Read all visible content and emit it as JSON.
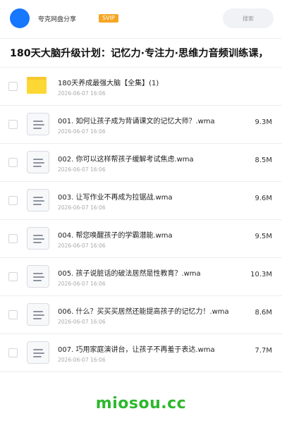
{
  "header": {
    "brand": "夸克网盘分享",
    "badge": "SVIP",
    "search_placeholder": "搜索"
  },
  "title": "180天大脑升级计划：记忆力·专注力·思维力音频训练课，",
  "files": [
    {
      "type": "folder",
      "name": "180天养成最强大脑【全集】(1)",
      "date": "2026-06-07 16:06",
      "size": ""
    },
    {
      "type": "audio",
      "name": "001. 如何让孩子成为背诵课文的记忆大师？.wma",
      "date": "2026-06-07 16:06",
      "size": "9.3M"
    },
    {
      "type": "audio",
      "name": "002. 你可以这样帮孩子缓解考试焦虑.wma",
      "date": "2026-06-07 16:06",
      "size": "8.5M"
    },
    {
      "type": "audio",
      "name": "003. 让写作业不再成为拉锯战.wma",
      "date": "2026-06-07 16:06",
      "size": "9.6M"
    },
    {
      "type": "audio",
      "name": "004. 帮您唤醒孩子的学霸潜能.wma",
      "date": "2026-06-07 16:06",
      "size": "9.5M"
    },
    {
      "type": "audio",
      "name": "005. 孩子说脏话的破法居然是性教育？.wma",
      "date": "2026-06-07 16:06",
      "size": "10.3M"
    },
    {
      "type": "audio",
      "name": "006. 什么？买买买居然还能提高孩子的记忆力！.wma",
      "date": "2026-06-07 16:06",
      "size": "8.6M"
    },
    {
      "type": "audio",
      "name": "007. 巧用家庭演讲台，让孩子不再羞于表达.wma",
      "date": "2026-06-07 16:06",
      "size": "7.7M"
    }
  ],
  "footer": "miosou.cc",
  "colors": {
    "accent": "#1677ff",
    "badge": "#f5a623",
    "folder": "#fdd835",
    "footer": "#2db82d"
  }
}
